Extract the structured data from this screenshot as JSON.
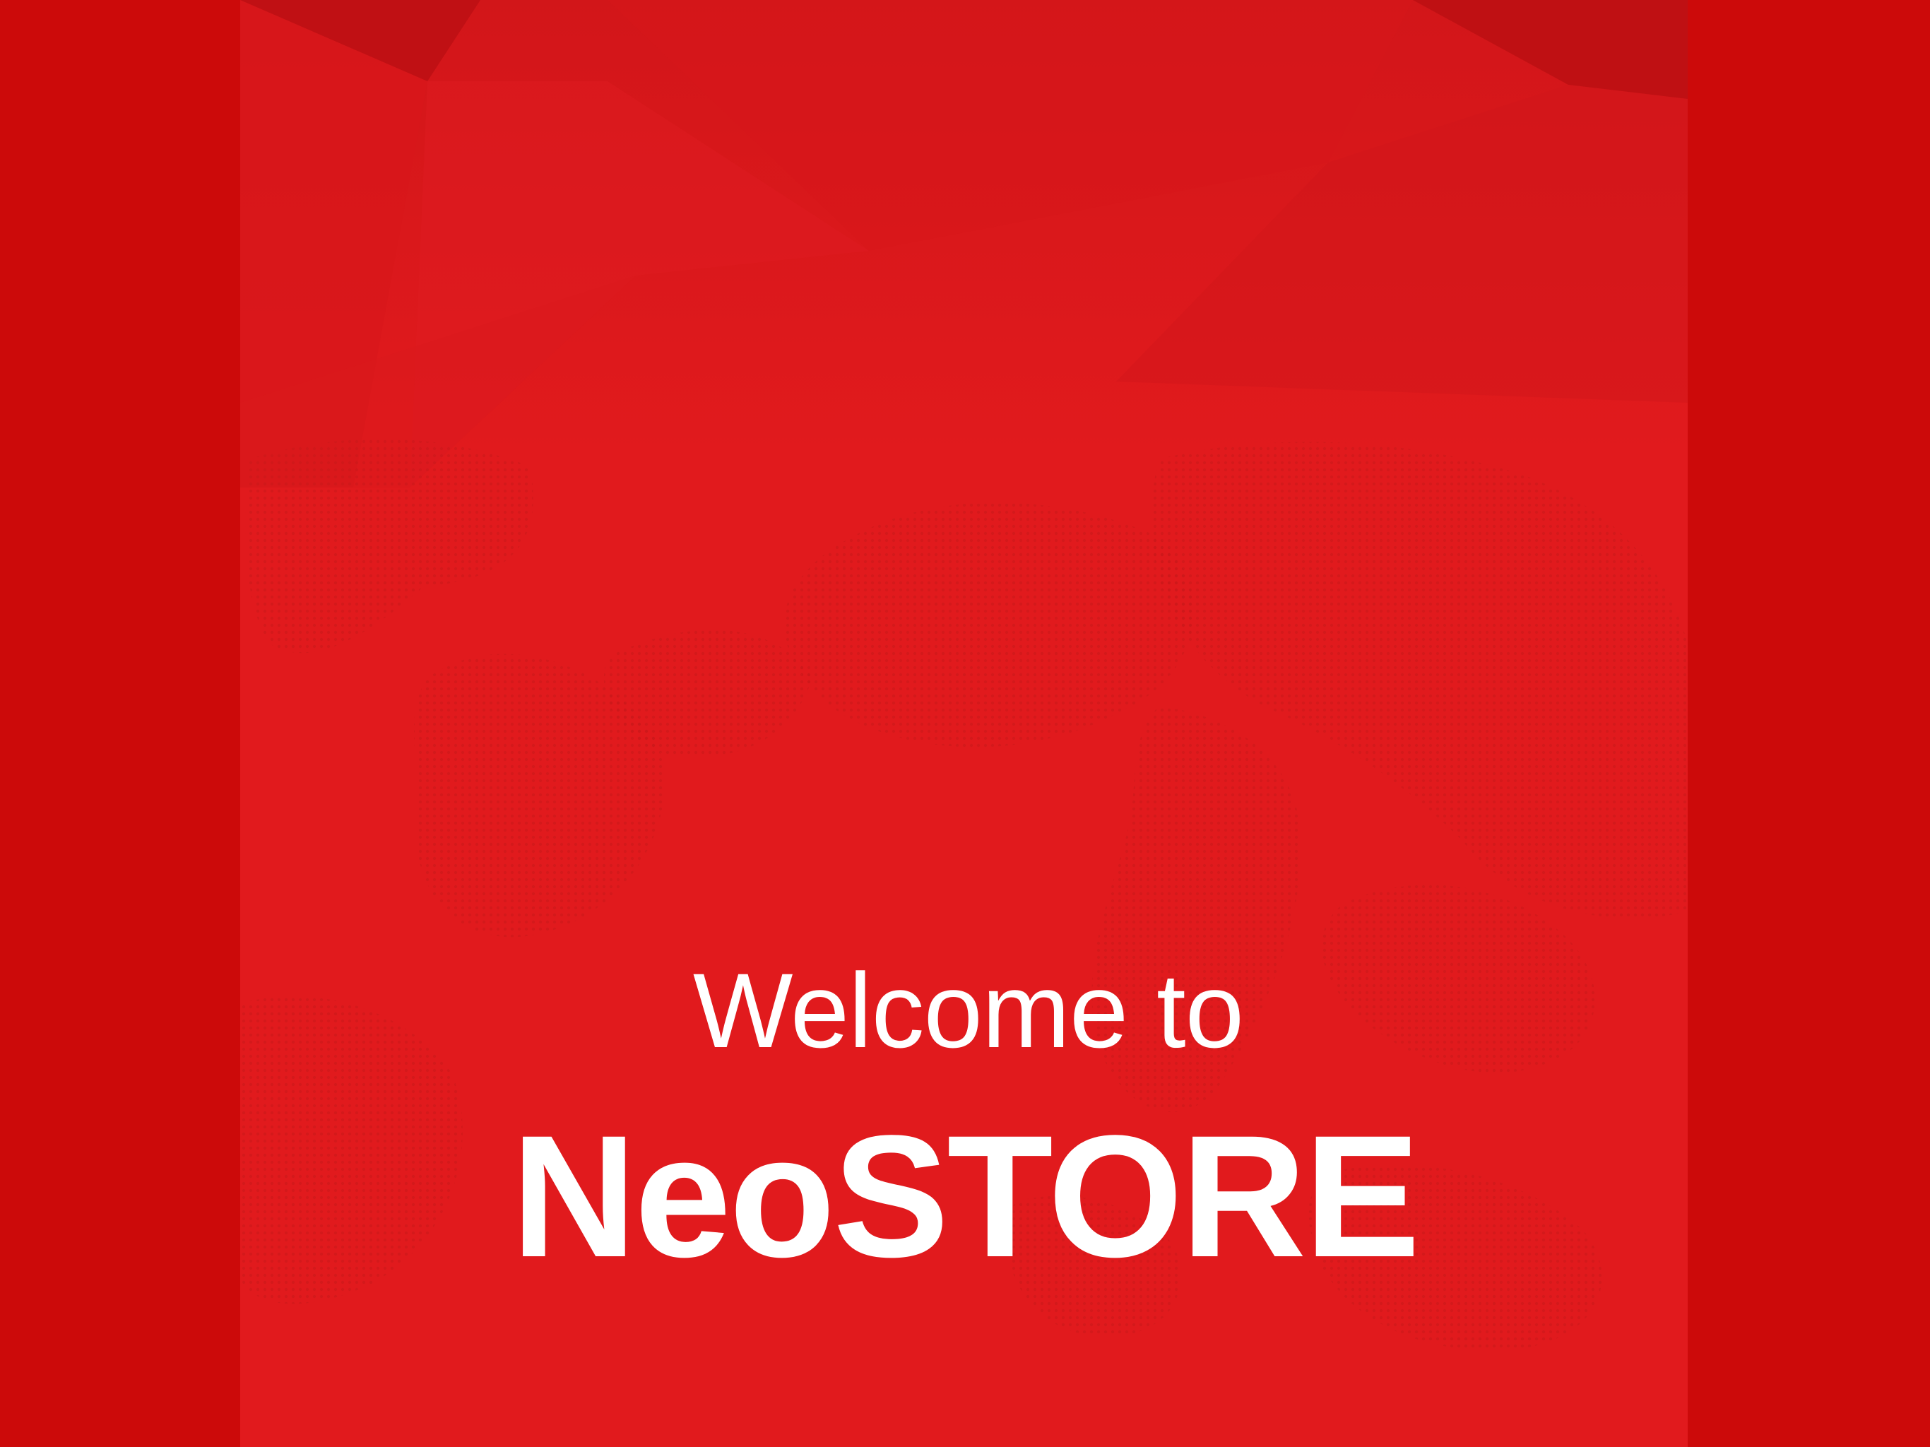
{
  "screen": {
    "welcome_text": "Welcome to",
    "brand_name": "NeoSTORE"
  },
  "colors": {
    "outer_background": "#cc0a0a",
    "panel_red": "#e31b1e",
    "text": "#ffffff"
  },
  "background": {
    "pattern": "dotted-world-map"
  }
}
